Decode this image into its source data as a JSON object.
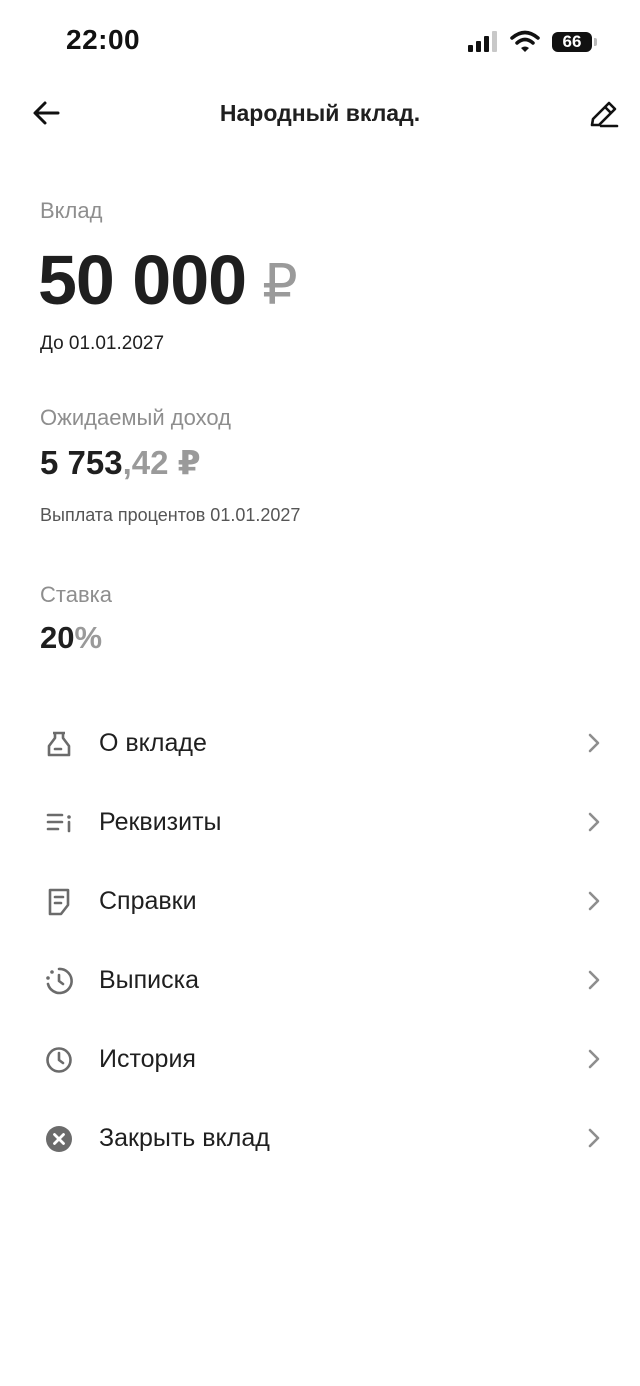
{
  "status_bar": {
    "time": "22:00",
    "battery": "66"
  },
  "header": {
    "title": "Народный вклад.",
    "back_icon": "arrow-left-icon",
    "edit_icon": "pencil-icon"
  },
  "deposit": {
    "label": "Вклад",
    "amount": "50 000",
    "currency": "₽",
    "until": "До 01.01.2027"
  },
  "income": {
    "label": "Ожидаемый доход",
    "amount_int": "5 753",
    "amount_frac": ",42 ₽",
    "payout": "Выплата процентов 01.01.2027"
  },
  "rate": {
    "label": "Ставка",
    "value": "20",
    "unit": "%"
  },
  "menu": {
    "items": [
      {
        "label": "О вкладе",
        "icon": "jar-icon"
      },
      {
        "label": "Реквизиты",
        "icon": "details-list-icon"
      },
      {
        "label": "Справки",
        "icon": "document-icon"
      },
      {
        "label": "Выписка",
        "icon": "statement-clock-icon"
      },
      {
        "label": "История",
        "icon": "clock-icon"
      },
      {
        "label": "Закрыть вклад",
        "icon": "close-circle-icon"
      }
    ]
  },
  "colors": {
    "text": "#1f1f1f",
    "muted": "#8e8e8e",
    "background": "#ffffff"
  }
}
